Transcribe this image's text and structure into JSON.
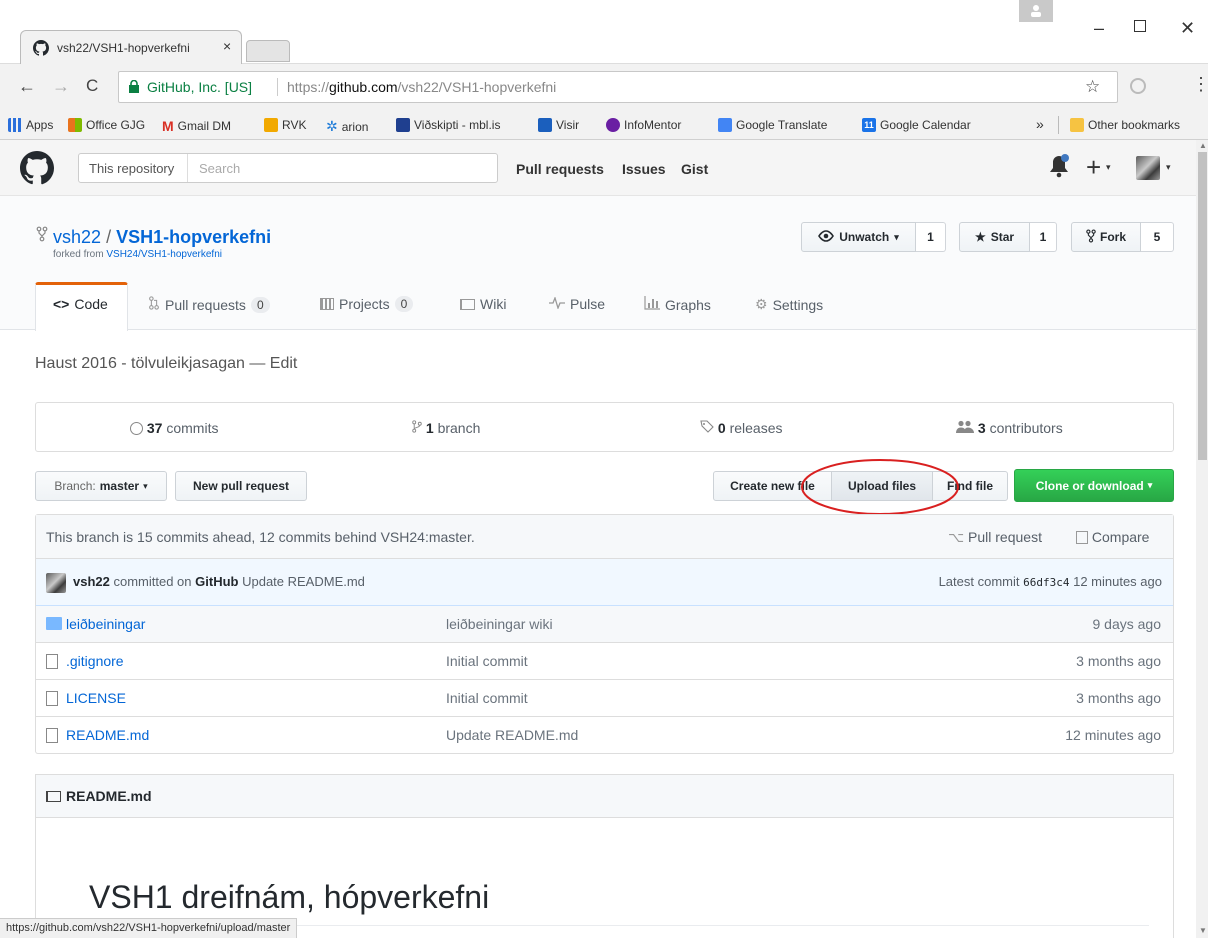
{
  "browser": {
    "tab_title": "vsh22/VSH1-hopverkefni",
    "tab_close": "×",
    "security_label": "GitHub, Inc. [US]",
    "url_prefix": "https://",
    "url_host": "github.com",
    "url_path": "/vsh22/VSH1-hopverkefni",
    "status_url": "https://github.com/vsh22/VSH1-hopverkefni/upload/master",
    "bookmarks": [
      {
        "label": "Apps",
        "color": "#2a6fdb"
      },
      {
        "label": "Office GJG",
        "color": "#e9731d"
      },
      {
        "label": "Gmail DM",
        "color": "#d93025"
      },
      {
        "label": "RVK",
        "color": "#f2a900"
      },
      {
        "label": "arion",
        "color": "#1e7bd8"
      },
      {
        "label": "Viðskipti - mbl.is",
        "color": "#1f3f8f"
      },
      {
        "label": "Visir",
        "color": "#1b5fbd"
      },
      {
        "label": "InfoMentor",
        "color": "#6a1fa3"
      },
      {
        "label": "Google Translate",
        "color": "#4285f4"
      },
      {
        "label": "Google Calendar",
        "color": "#1a73e8"
      }
    ],
    "more_bookmarks": "»",
    "other_bookmarks": "Other bookmarks"
  },
  "github": {
    "search_scope": "This repository",
    "search_placeholder": "Search",
    "nav": [
      "Pull requests",
      "Issues",
      "Gist"
    ]
  },
  "repo": {
    "owner": "vsh22",
    "separator": "/",
    "name": "VSH1-hopverkefni",
    "forked_prefix": "forked from ",
    "forked_from": "VSH24/VSH1-hopverkefni",
    "unwatch_label": "Unwatch",
    "unwatch_count": "1",
    "star_label": "Star",
    "star_count": "1",
    "fork_label": "Fork",
    "fork_count": "5",
    "tabs": {
      "code": "Code",
      "pulls": "Pull requests",
      "pulls_count": "0",
      "projects": "Projects",
      "projects_count": "0",
      "wiki": "Wiki",
      "pulse": "Pulse",
      "graphs": "Graphs",
      "settings": "Settings"
    },
    "description": "Haust 2016 - tölvuleikjasagan — Edit"
  },
  "numbers": {
    "commits_n": "37",
    "commits_l": " commits",
    "branch_n": "1",
    "branch_l": " branch",
    "releases_n": "0",
    "releases_l": " releases",
    "contributors_n": "3",
    "contributors_l": " contributors"
  },
  "file_nav": {
    "branch_prefix": "Branch: ",
    "branch": "master",
    "new_pr": "New pull request",
    "create_file": "Create new file",
    "upload_files": "Upload files",
    "find_file": "Find file",
    "clone": "Clone or download"
  },
  "branch_status": {
    "text": "This branch is 15 commits ahead, 12 commits behind VSH24:master.",
    "pull_request": "Pull request",
    "compare": "Compare"
  },
  "latest_commit": {
    "author": "vsh22",
    "committed_on": " committed on ",
    "platform": "GitHub",
    "message": "Update README.md",
    "latest_label": "Latest commit ",
    "sha": "66df3c4",
    "age": "12 minutes ago"
  },
  "files": [
    {
      "name": "leiðbeiningar",
      "message": "leiðbeiningar wiki",
      "age": "9 days ago",
      "type": "folder"
    },
    {
      "name": ".gitignore",
      "message": "Initial commit",
      "age": "3 months ago",
      "type": "file"
    },
    {
      "name": "LICENSE",
      "message": "Initial commit",
      "age": "3 months ago",
      "type": "file"
    },
    {
      "name": "README.md",
      "message": "Update README.md",
      "age": "12 minutes ago",
      "type": "file"
    }
  ],
  "readme": {
    "header": "README.md",
    "title": "VSH1 dreifnám, hópverkefni"
  },
  "colors": {
    "link": "#0366d6",
    "clone_green": "#28a745",
    "annotation_red": "#d92020",
    "tab_accent": "#e36209"
  }
}
